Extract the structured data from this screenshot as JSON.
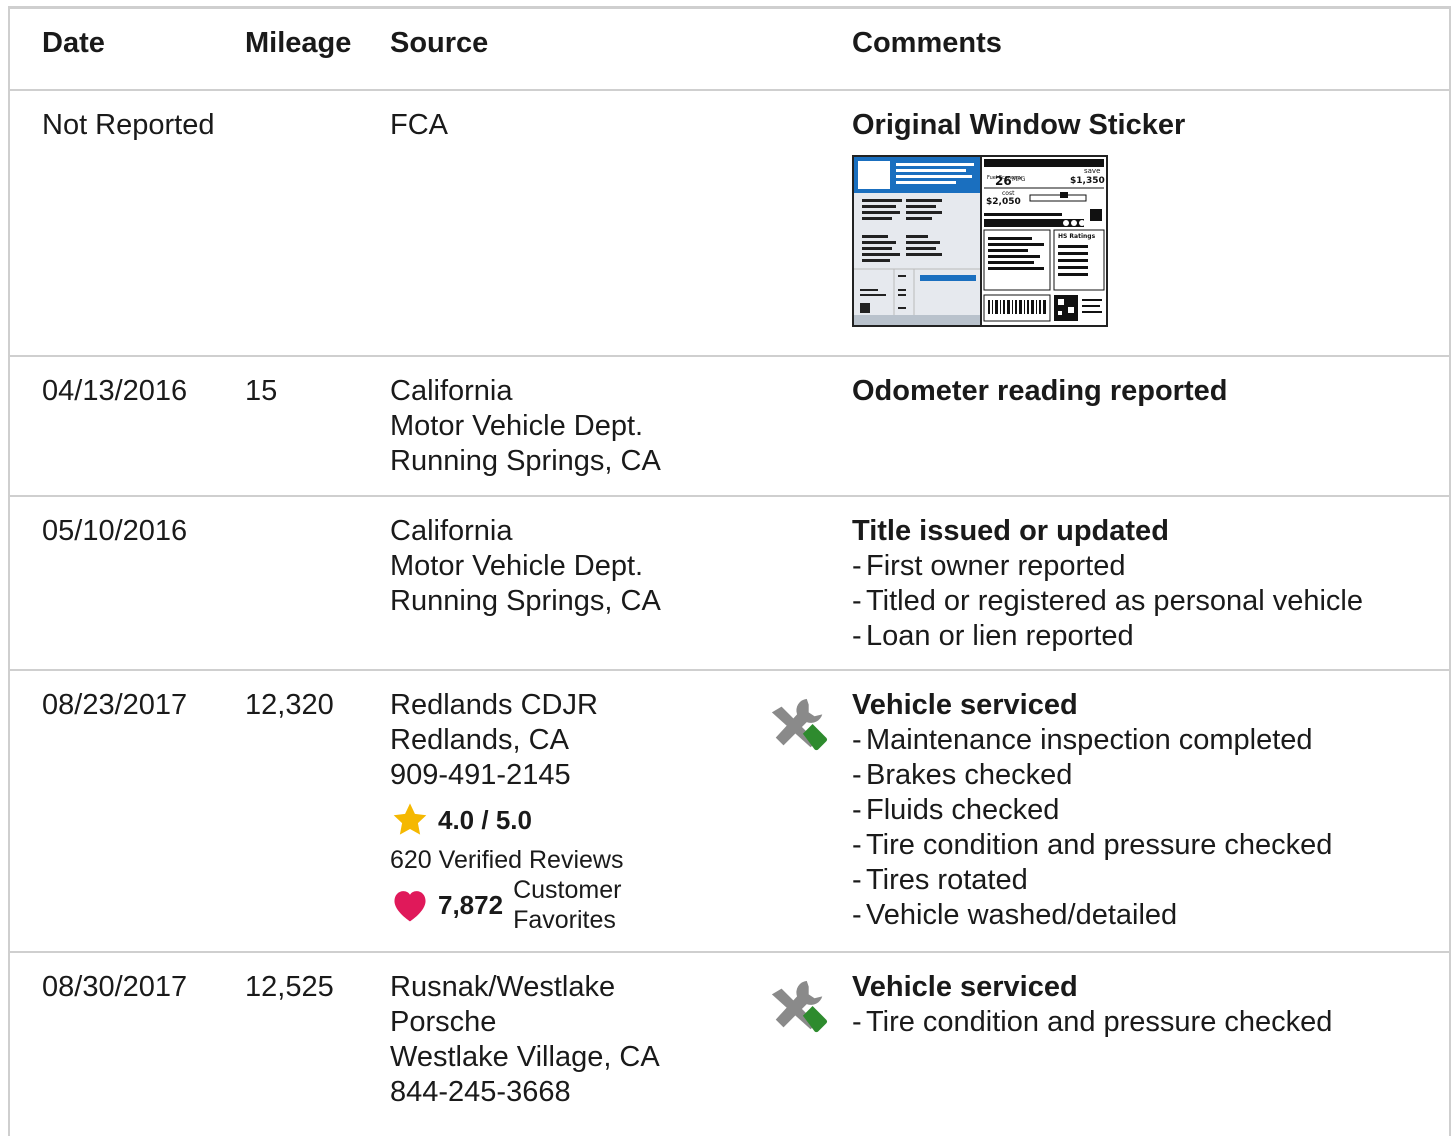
{
  "header": {
    "date": "Date",
    "mileage": "Mileage",
    "source": "Source",
    "comments": "Comments"
  },
  "rows": [
    {
      "date": "Not Reported",
      "mileage": "",
      "source": [
        "FCA"
      ],
      "comment_title": "Original Window Sticker",
      "sticker": {
        "mpg": "26",
        "mpg_unit": "MPG",
        "save": "save",
        "save_amount": "$1,350",
        "cost_label": "cost",
        "cost_amount": "$2,050",
        "ratings": "HS Ratings"
      }
    },
    {
      "date": "04/13/2016",
      "mileage": "15",
      "source": [
        "California",
        "Motor Vehicle Dept.",
        "Running Springs, CA"
      ],
      "comment_title": "Odometer reading reported"
    },
    {
      "date": "05/10/2016",
      "mileage": "",
      "source": [
        "California",
        "Motor Vehicle Dept.",
        "Running Springs, CA"
      ],
      "comment_title": "Title issued or updated",
      "comment_items": [
        "First owner reported",
        "Titled or registered as personal vehicle",
        "Loan or lien reported"
      ]
    },
    {
      "date": "08/23/2017",
      "mileage": "12,320",
      "source": [
        "Redlands CDJR",
        "Redlands, CA",
        "909-491-2145"
      ],
      "rating": "4.0 / 5.0",
      "reviews": "620 Verified Reviews",
      "favorites_count": "7,872",
      "favorites_label": [
        "Customer",
        "Favorites"
      ],
      "comment_title": "Vehicle serviced",
      "comment_items": [
        "Maintenance inspection completed",
        "Brakes checked",
        "Fluids checked",
        "Tire condition and pressure checked",
        "Tires rotated",
        "Vehicle washed/detailed"
      ]
    },
    {
      "date": "08/30/2017",
      "mileage": "12,525",
      "source": [
        "Rusnak/Westlake",
        "Porsche",
        "Westlake Village, CA",
        "844-245-3668"
      ],
      "comment_title": "Vehicle serviced",
      "comment_items": [
        "Tire condition and pressure checked"
      ]
    }
  ],
  "colors": {
    "star": "#f5b800",
    "heart": "#e0195a",
    "wrench_handle": "#2e8b2e",
    "wrench_metal": "#8a8a8a",
    "sticker_blue": "#1a6fbf",
    "border": "#cfcfcf"
  }
}
